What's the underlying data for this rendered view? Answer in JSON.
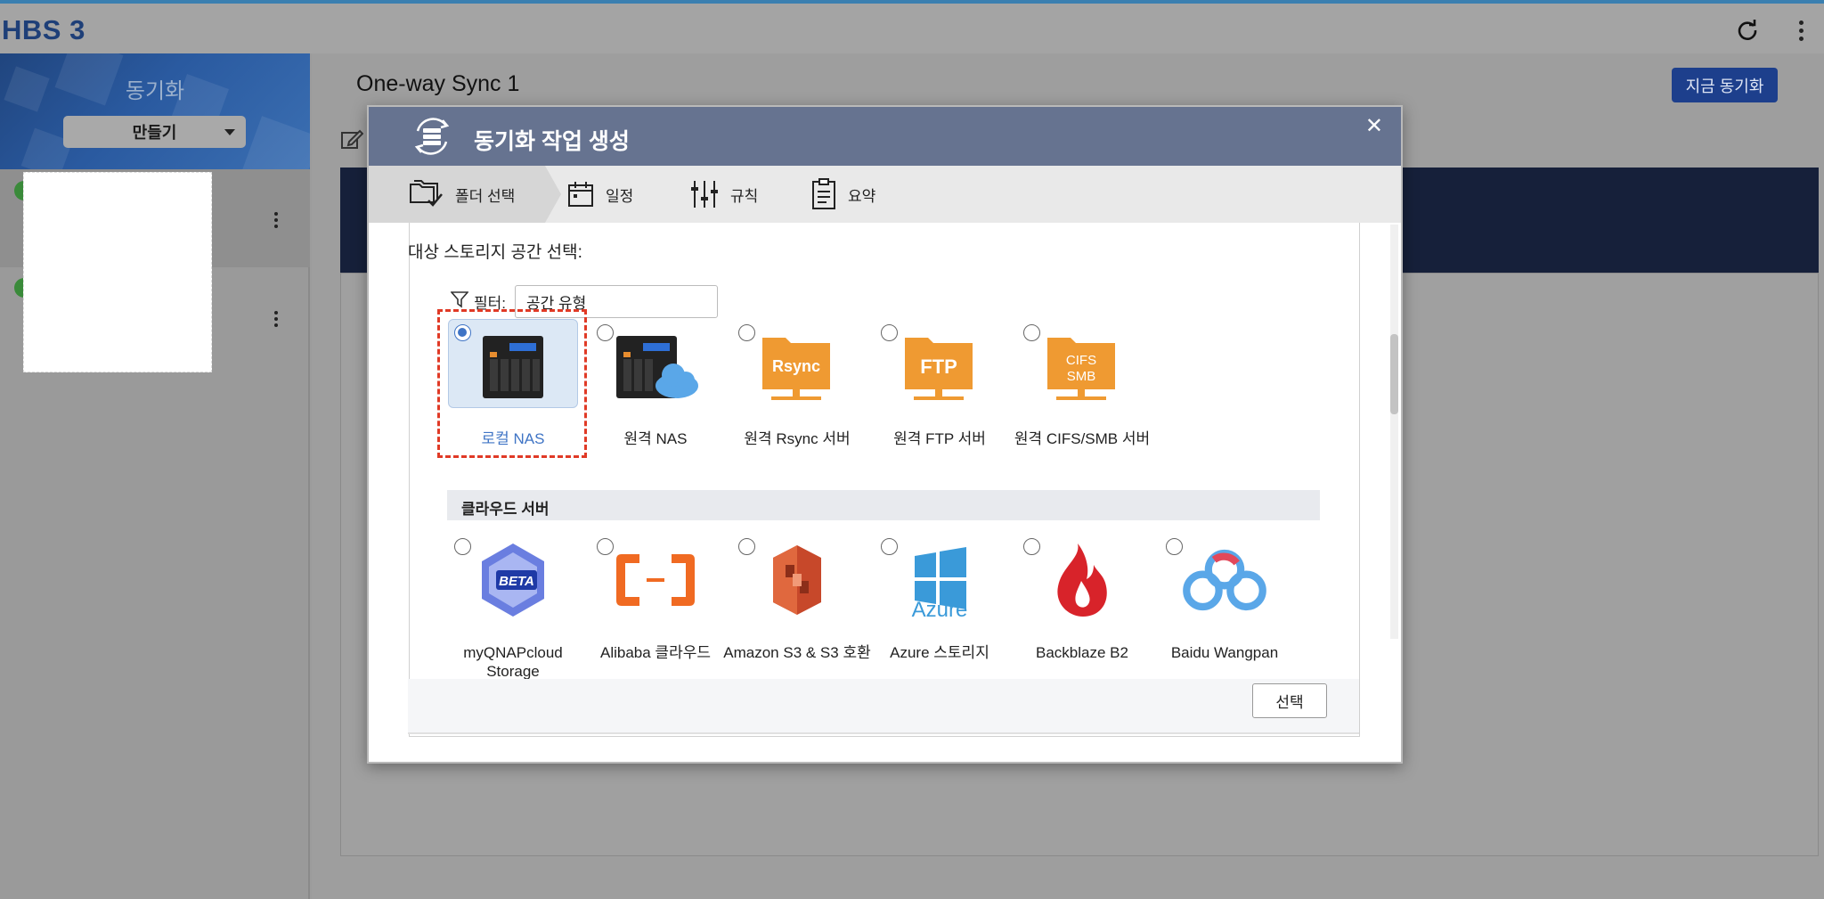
{
  "app": {
    "title": "HBS 3"
  },
  "topbar": {
    "refresh_icon": "refresh-icon",
    "more_icon": "more-vertical-icon"
  },
  "sidebar": {
    "title": "동기화",
    "create_label": "만들기"
  },
  "main": {
    "job_title": "One-way Sync 1",
    "sync_now_label": "지금 동기화"
  },
  "modal": {
    "title": "동기화 작업 생성",
    "steps": [
      {
        "label": "폴더 선택",
        "icon": "folder-select-icon"
      },
      {
        "label": "일정",
        "icon": "calendar-icon"
      },
      {
        "label": "규칙",
        "icon": "sliders-icon"
      },
      {
        "label": "요약",
        "icon": "clipboard-icon"
      }
    ],
    "section_label": "대상 스토리지 공간 선택:",
    "filter_label": "필터:",
    "filter_value": "공간 유형",
    "storage_options": [
      {
        "label": "로컬 NAS",
        "selected": true,
        "icon": "local-nas-icon"
      },
      {
        "label": "원격 NAS",
        "selected": false,
        "icon": "remote-nas-icon"
      },
      {
        "label": "원격 Rsync 서버",
        "selected": false,
        "icon": "rsync-folder-icon",
        "badge": "Rsync"
      },
      {
        "label": "원격 FTP 서버",
        "selected": false,
        "icon": "ftp-folder-icon",
        "badge": "FTP"
      },
      {
        "label": "원격 CIFS/SMB 서버",
        "selected": false,
        "icon": "cifs-smb-folder-icon",
        "badge_line1": "CIFS",
        "badge_line2": "SMB"
      }
    ],
    "cloud_header": "클라우드 서버",
    "cloud_options": [
      {
        "label": "myQNAPcloud Storage",
        "icon": "myqnapcloud-icon",
        "badge": "BETA"
      },
      {
        "label": "Alibaba 클라우드",
        "icon": "alibaba-cloud-icon"
      },
      {
        "label": "Amazon S3 & S3 호환",
        "icon": "amazon-s3-icon"
      },
      {
        "label": "Azure 스토리지",
        "icon": "azure-icon",
        "badge": "Azure"
      },
      {
        "label": "Backblaze B2",
        "icon": "backblaze-icon"
      },
      {
        "label": "Baidu Wangpan",
        "icon": "baidu-wangpan-icon"
      }
    ],
    "select_label": "선택",
    "close_icon": "close-icon"
  },
  "colors": {
    "brand_dark_blue": "#1e3f78",
    "modal_header": "#667390",
    "accent_blue": "#3f74c5",
    "folder_orange": "#ef9a32",
    "highlight_red": "#e03a26",
    "sync_button": "#1d3f8c"
  }
}
